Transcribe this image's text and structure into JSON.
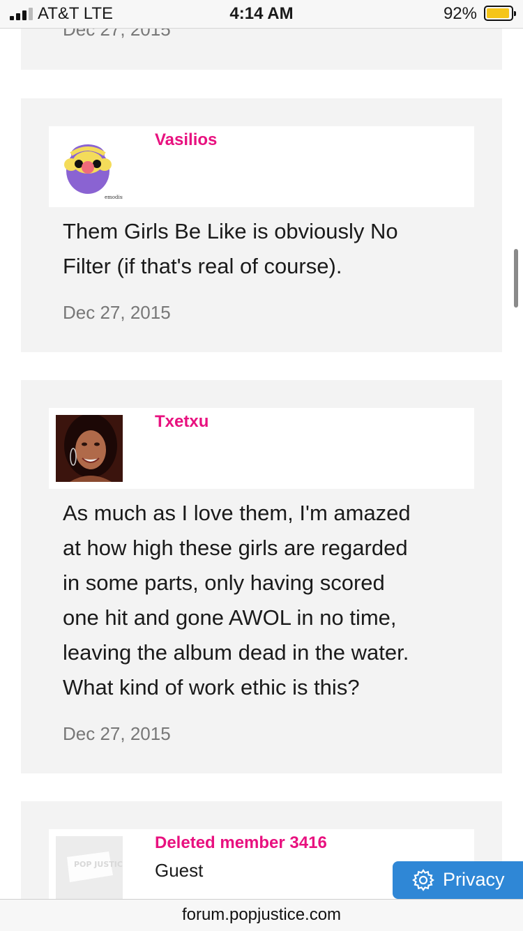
{
  "status_bar": {
    "carrier": "AT&T  LTE",
    "time": "4:14 AM",
    "battery_percent": "92%"
  },
  "posts": [
    {
      "date": "Dec 27, 2015"
    },
    {
      "username": "Vasilios",
      "avatar": "cartoon-bearded-face-avatar",
      "avatar_caption": "emodiss",
      "lines": [
        "Them Girls Be Like is obviously No",
        "Filter (if that's real of course)."
      ],
      "date": "Dec 27, 2015"
    },
    {
      "username": "Txetxu",
      "avatar": "smiling-woman-photo-avatar",
      "lines": [
        "As much as I love them, I'm amazed",
        "at how high these girls are regarded",
        "in some parts, only having scored",
        "one hit and gone AWOL in no time,",
        "leaving the album dead in the water.",
        "What kind of work ethic is this?"
      ],
      "date": "Dec 27, 2015"
    },
    {
      "username": "Deleted member 3416",
      "user_title": "Guest",
      "avatar": "popjustice-placeholder-avatar",
      "avatar_caption": "POP JUSTICE"
    }
  ],
  "privacy_button": {
    "label": "Privacy",
    "icon": "gear-icon",
    "color": "#2f87d6"
  },
  "browser": {
    "url": "forum.popjustice.com"
  },
  "colors": {
    "username": "#e8117f",
    "post_bg": "#f3f3f3"
  }
}
